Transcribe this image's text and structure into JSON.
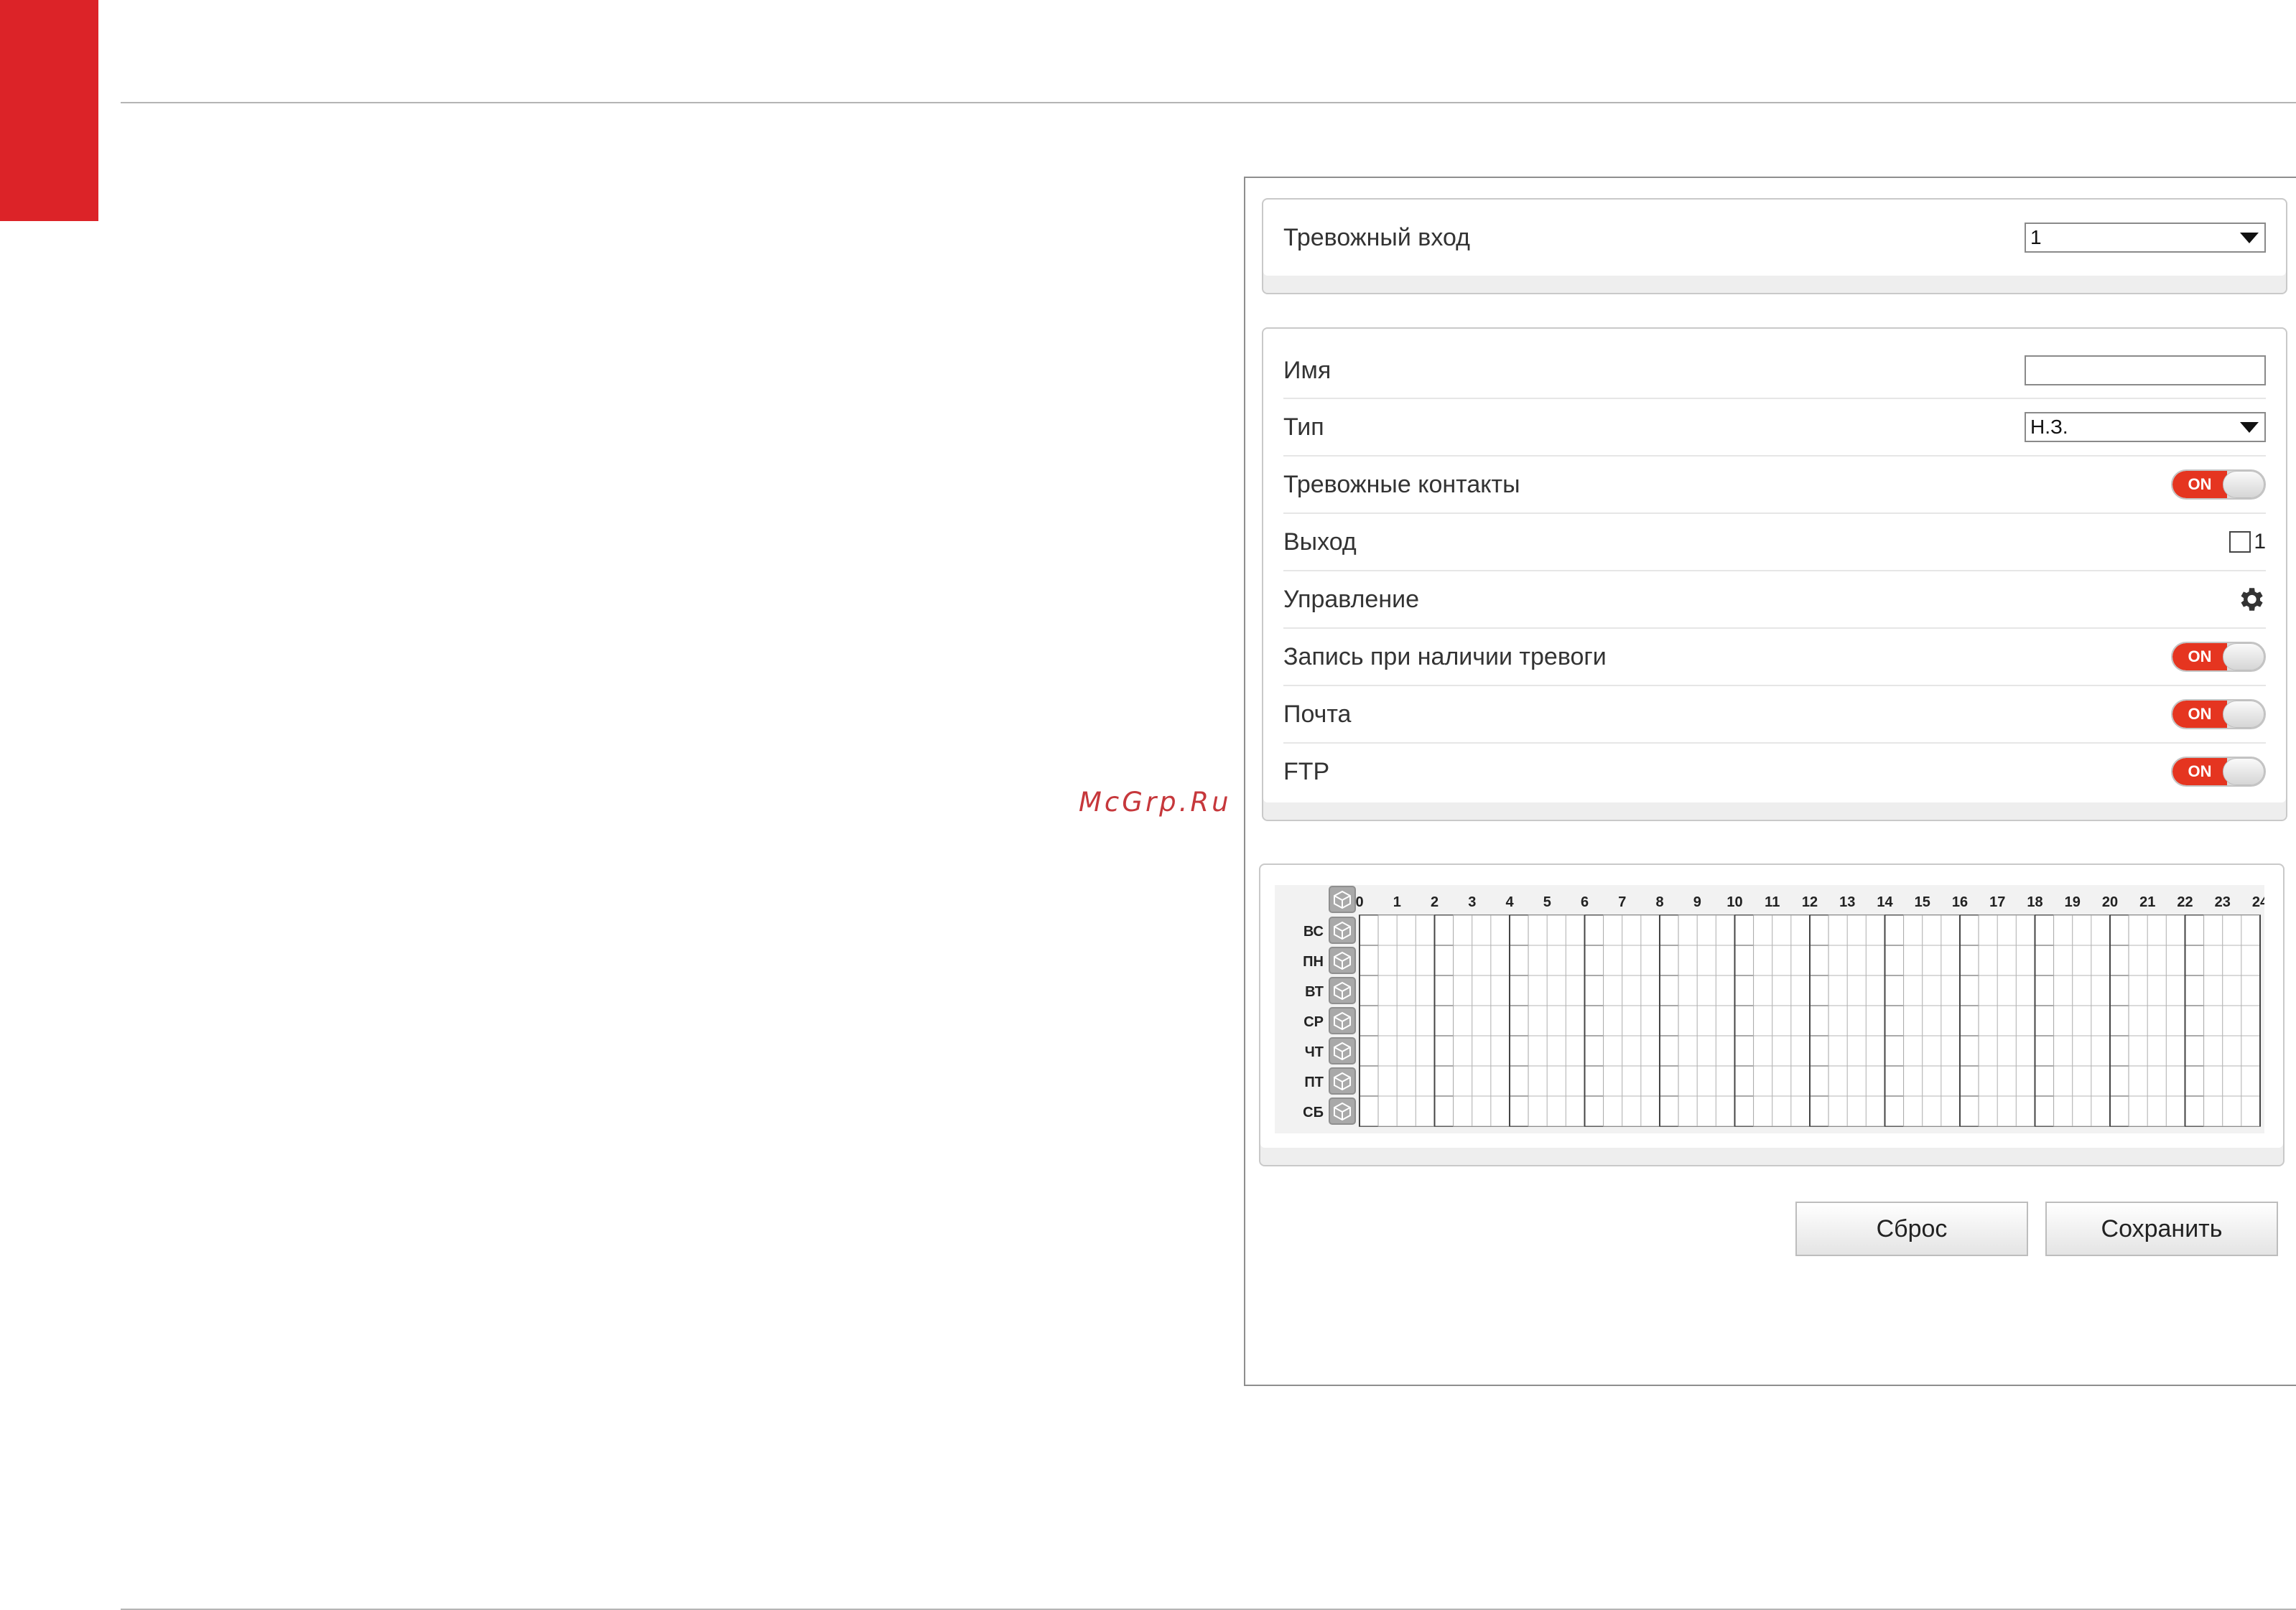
{
  "watermark": "McGrp.Ru",
  "alarm_input": {
    "label": "Тревожный вход",
    "value": "1"
  },
  "settings": {
    "name": {
      "label": "Имя",
      "value": ""
    },
    "type": {
      "label": "Тип",
      "value": "Н.З."
    },
    "alarm_contacts": {
      "label": "Тревожные контакты",
      "state": "ON"
    },
    "output": {
      "label": "Выход",
      "checkbox_label": "1",
      "checked": false
    },
    "control": {
      "label": "Управление",
      "icon": "gear-icon"
    },
    "record_on_alarm": {
      "label": "Запись при наличии тревоги",
      "state": "ON"
    },
    "mail": {
      "label": "Почта",
      "state": "ON"
    },
    "ftp": {
      "label": "FTP",
      "state": "ON"
    }
  },
  "schedule": {
    "hours": [
      "0",
      "1",
      "2",
      "3",
      "4",
      "5",
      "6",
      "7",
      "8",
      "9",
      "10",
      "11",
      "12",
      "13",
      "14",
      "15",
      "16",
      "17",
      "18",
      "19",
      "20",
      "21",
      "22",
      "23",
      "24"
    ],
    "days": [
      "ВС",
      "ПН",
      "ВТ",
      "СР",
      "ЧТ",
      "ПТ",
      "СБ"
    ],
    "cells_per_hour": 2,
    "select_icon": "cube-icon"
  },
  "buttons": {
    "reset": "Сброс",
    "save": "Сохранить"
  },
  "colors": {
    "accent": "#dc2328",
    "toggle_on": "#e53520",
    "border": "#c9c9c9"
  }
}
